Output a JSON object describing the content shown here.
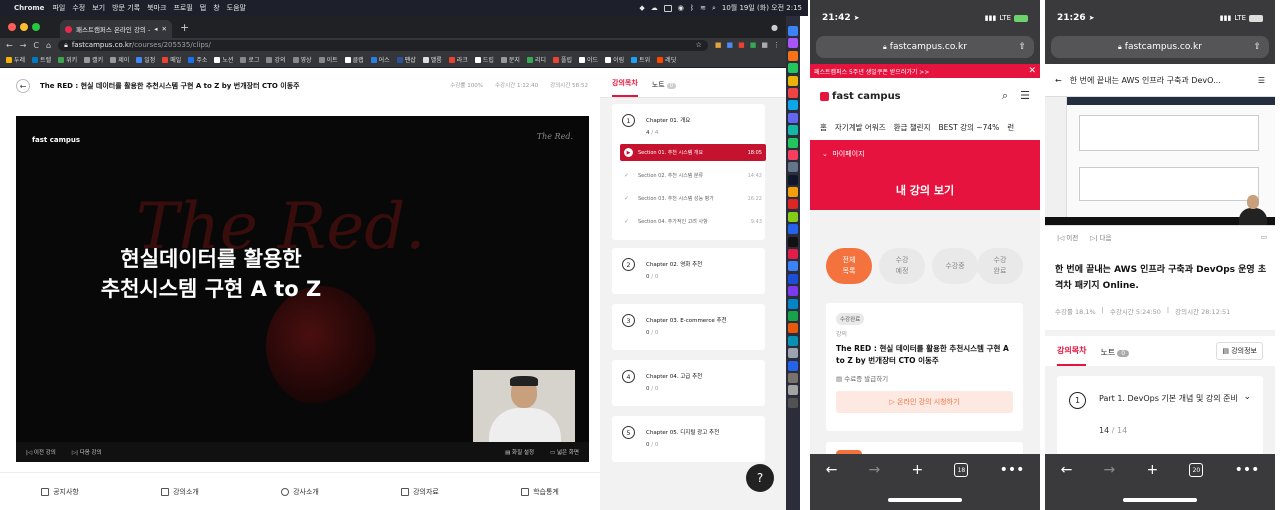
{
  "desktop": {
    "menubar": {
      "app": "Chrome",
      "items": [
        "파일",
        "수정",
        "보기",
        "방문 기록",
        "북마크",
        "프로필",
        "탭",
        "창",
        "도움말"
      ],
      "datetime": "10월 19일 (화) 오전 2:15"
    },
    "tab": {
      "title": "패스트캠퍼스 온라인 강의 - Th"
    },
    "url": {
      "host": "fastcampus.co.kr",
      "path": "/courses/205535/clips/"
    },
    "bookmarks": [
      "두레",
      "트렐",
      "위키",
      "캘키",
      "제이",
      "일정",
      "메일",
      "주소",
      "노션",
      "로그",
      "강의",
      "영상",
      "이트",
      "클랩",
      "어스",
      "팬샵",
      "밸룸",
      "라크",
      "드립",
      "문지",
      "리디",
      "플립",
      "이드",
      "이림",
      "트위",
      "레딧"
    ],
    "course": {
      "title": "The RED : 현실 데이터를 활용한 추천시스템 구현 A to Z by 번개장터 CTO 이동주",
      "progress": "수강률 100%",
      "study_time": "수강시간 1:12:40",
      "lecture_time": "강의시간 58:52"
    },
    "video": {
      "logo": "fast campus",
      "signature": "The Red.",
      "background_text": "The Red.",
      "headline_line1": "현실데이터를 활용한",
      "headline_line2": "추천시스템 구현 A to Z",
      "prev": "이전 강의",
      "next": "다음 강의",
      "settings": "화질 설정",
      "fullscreen": "넓은 화면"
    },
    "bottom_nav": [
      "공지사항",
      "강의소개",
      "강사소개",
      "강의자료",
      "학습통계"
    ],
    "side": {
      "tab_toc": "강의목차",
      "tab_notes": "노트",
      "notes_count": "0",
      "chapter1": {
        "num": "1",
        "title": "Chapter 01. 개요",
        "done": "4",
        "total": "/ 4",
        "sections": [
          {
            "name": "Section 01. 추천 시스템 개요",
            "dur": "18:05"
          },
          {
            "name": "Section 02. 추천 시스템 분류",
            "dur": "14:42"
          },
          {
            "name": "Section 03. 추천 시스템 성능 평가",
            "dur": "16:22"
          },
          {
            "name": "Section 04. 추가적인 고려 사항",
            "dur": "9:43"
          }
        ]
      },
      "chapters": [
        {
          "num": "2",
          "title": "Chapter 02. 영화 추천",
          "done": "0",
          "total": "/ 0"
        },
        {
          "num": "3",
          "title": "Chapter 03. E-commerce 추천",
          "done": "0",
          "total": "/ 0"
        },
        {
          "num": "4",
          "title": "Chapter 04. 고급 추천",
          "done": "0",
          "total": "/ 0"
        },
        {
          "num": "5",
          "title": "Chapter 05. 디지털 광고 추천",
          "done": "0",
          "total": "/ 0"
        }
      ],
      "help": "?"
    }
  },
  "phone1": {
    "time": "21:42",
    "network": "LTE",
    "url": "fastcampus.co.kr",
    "promo": "패스트캠퍼스 5주년 생일쿠폰 받으러가기 >>",
    "logo": "fast campus",
    "nav": [
      "홈",
      "자기계발 어워즈",
      "환급 챌린지",
      "BEST 강의 ~74%",
      "런"
    ],
    "mypage_label": "마이페이지",
    "mypage_title": "내 강의 보기",
    "filters": [
      "전체\n목록",
      "수강\n예정",
      "수강중",
      "수강\n완료"
    ],
    "card": {
      "badge": "수강완료",
      "kind": "강의",
      "title": "The RED : 현실 데이터를 활용한 추천시스템 구현 A to Z by 번개장터 CTO 이동주",
      "cert": "수료증 발급하기",
      "watch": "온라인 강의 시청하기"
    },
    "tabs_count": "18"
  },
  "phone2": {
    "time": "21:26",
    "network": "LTE",
    "url": "fastcampus.co.kr",
    "header_title": "한 번에 끝내는 AWS 인프라 구축과 DevO...",
    "prev": "이전",
    "next": "다음",
    "title": "한 번에 끝내는 AWS 인프라 구축과 DevOps 운영 초격차 패키지 Online.",
    "progress": "수강률 18.1%",
    "study_time": "수강시간 5:24:50",
    "lecture_time": "강의시간 28:12:51",
    "tab_toc": "강의목차",
    "tab_notes": "노트",
    "notes_count": "0",
    "info": "강의정보",
    "part": {
      "num": "1",
      "title": "Part 1. DevOps 기본 개념 및 강의 준비",
      "done": "14",
      "total": "/ 14"
    },
    "tabs_count": "20"
  },
  "colors": {
    "brand": "#e5133d",
    "active_section": "#c4122f",
    "filter_active": "#f3723e"
  },
  "icons": [
    "apple-icon",
    "back-arrow-icon",
    "play-icon",
    "check-icon",
    "help-icon",
    "search-icon",
    "menu-icon",
    "lock-icon",
    "share-icon",
    "chevron-down-icon",
    "plus-icon",
    "more-icon"
  ]
}
